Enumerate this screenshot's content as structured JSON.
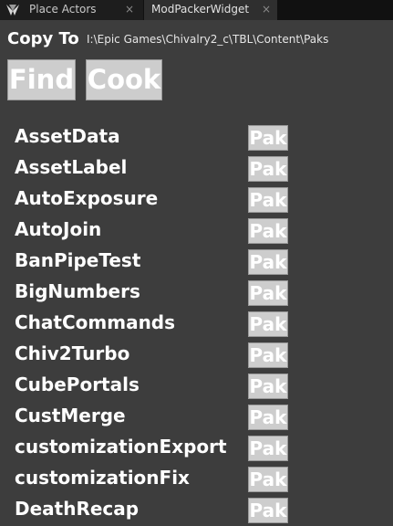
{
  "tabs": [
    {
      "label": "Place Actors",
      "icon": "place-actors-icon",
      "close": "×"
    },
    {
      "label": "ModPackerWidget",
      "close": "×"
    }
  ],
  "copy_to": {
    "label": "Copy To",
    "path": "I:\\Epic Games\\Chivalry2_c\\TBL\\Content\\Paks"
  },
  "buttons": {
    "find": "Find",
    "cook": "Cook"
  },
  "mods": [
    {
      "name": "AssetData",
      "pak": "Pak"
    },
    {
      "name": "AssetLabel",
      "pak": "Pak"
    },
    {
      "name": "AutoExposure",
      "pak": "Pak"
    },
    {
      "name": "AutoJoin",
      "pak": "Pak"
    },
    {
      "name": "BanPipeTest",
      "pak": "Pak"
    },
    {
      "name": "BigNumbers",
      "pak": "Pak"
    },
    {
      "name": "ChatCommands",
      "pak": "Pak"
    },
    {
      "name": "Chiv2Turbo",
      "pak": "Pak"
    },
    {
      "name": "CubePortals",
      "pak": "Pak"
    },
    {
      "name": "CustMerge",
      "pak": "Pak"
    },
    {
      "name": "customizationExport",
      "pak": "Pak"
    },
    {
      "name": "customizationFix",
      "pak": "Pak"
    },
    {
      "name": "DeathRecap",
      "pak": "Pak"
    }
  ],
  "colors": {
    "background": "#3d3d3d",
    "tab_bar": "#111111",
    "button_face": "#cdcdcd",
    "text": "#ffffff"
  }
}
